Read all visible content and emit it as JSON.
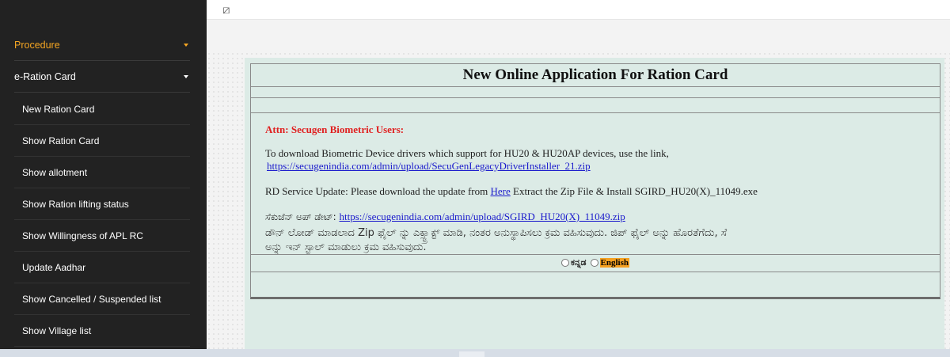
{
  "sidebar": {
    "procedure": "Procedure",
    "eration": "e-Ration Card",
    "items": [
      "New Ration Card",
      "Show Ration Card",
      "Show allotment",
      "Show Ration lifting status",
      "Show Willingness of APL RC",
      "Update Aadhar",
      "Show Cancelled / Suspended list",
      "Show Village list"
    ]
  },
  "topbar": {
    "toggle_glyph": "⧄"
  },
  "main": {
    "title": "New Online Application For Ration Card",
    "attn": "Attn: Secugen Biometric Users:",
    "bio_text": "To download Biometric Device drivers which support for HU20 & HU20AP devices, use the link,",
    "bio_link": "https://secugenindia.com/admin/upload/SecuGenLegacyDriverInstaller_21.zip",
    "rd_before": "RD Service Update: Please download the update from ",
    "rd_link": "Here",
    "rd_after": " Extract the Zip File & Install SGIRD_HU20(X)_11049.exe",
    "kn_label": "ಸೆಕುಜೆನ್ ಅಪ್ ಡೇಟ್: ",
    "kn_link": "https://secugenindia.com/admin/upload/SGIRD_HU20(X)_11049.zip",
    "kn_para1": "ಡೌನ್ ಲೋಡ್ ಮಾಡಲಾದ Zip ಫೈಲ್ ನ್ನು ಎಕ್ಸ್ಟ್ರಾಕ್ಟ್ ಮಾಡಿ, ನಂತರ ಅನುಸ್ಥಾಪಿಸಲು ಕ್ರಮ ವಹಿಸುವುದು. ಜಿಪ್ ಫೈಲ್ ಅನ್ನು ಹೊರತೆಗೆದು, ಸೆ",
    "kn_para2": "ಅನ್ನು ಇನ್ ಸ್ಟಾಲ್ ಮಾಡುಲು ಕ್ರಮ ವಹಿಸುವುದು.",
    "lang_kn": "ಕನ್ನಡ",
    "lang_en": "English"
  },
  "colors": {
    "sidebar_bg": "#222222",
    "accent_orange": "#f5a623",
    "panel_bg": "#dcebe6",
    "attn_red": "#e02020",
    "link_blue": "#1a1acc"
  }
}
